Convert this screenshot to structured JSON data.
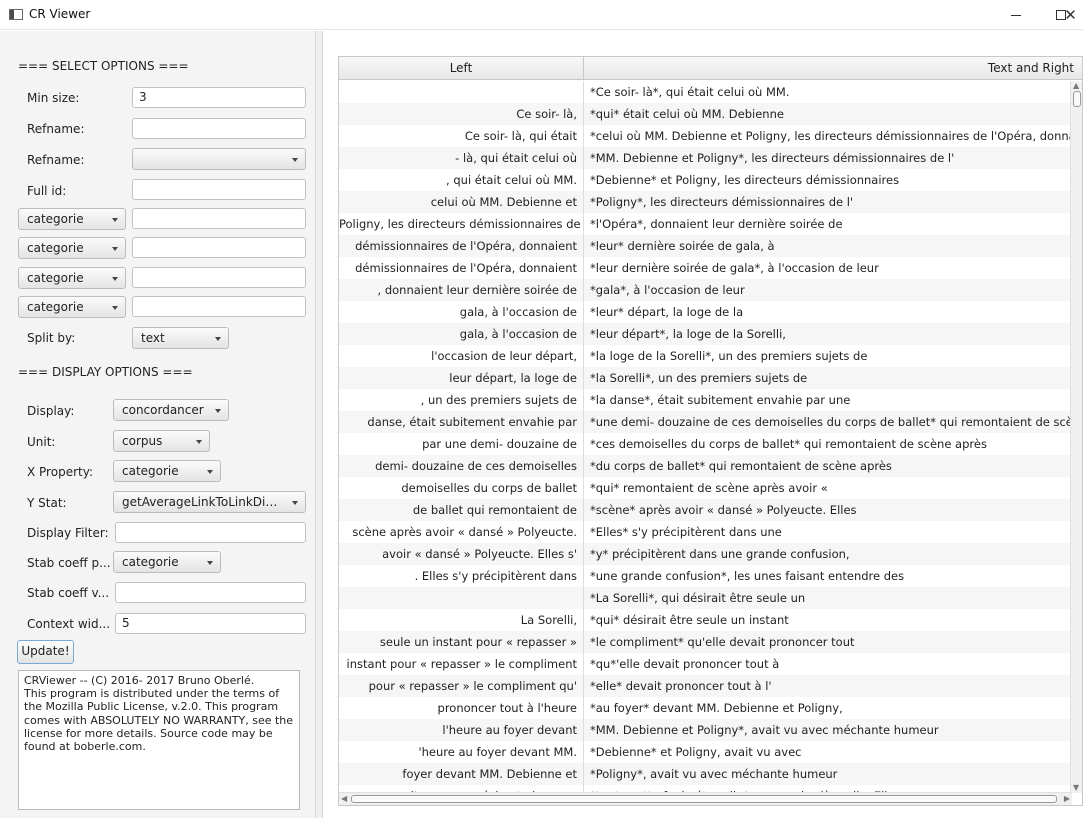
{
  "window": {
    "title": "CR Viewer",
    "controls": {
      "minimize": "–",
      "maximize": "☐",
      "close": "✕"
    }
  },
  "select_options": {
    "header": "=== SELECT OPTIONS ===",
    "min_size": {
      "label": "Min size:",
      "value": "3"
    },
    "refname_text": {
      "label": "Refname:",
      "value": ""
    },
    "refname_combo": {
      "label": "Refname:",
      "value": ""
    },
    "full_id": {
      "label": "Full id:",
      "value": ""
    },
    "categorie_filters": [
      {
        "combo": "categorie",
        "value": ""
      },
      {
        "combo": "categorie",
        "value": ""
      },
      {
        "combo": "categorie",
        "value": ""
      },
      {
        "combo": "categorie",
        "value": ""
      }
    ],
    "split_by": {
      "label": "Split by:",
      "value": "text"
    }
  },
  "display_options": {
    "header": "=== DISPLAY OPTIONS ===",
    "display": {
      "label": "Display:",
      "value": "concordancer"
    },
    "unit": {
      "label": "Unit:",
      "value": "corpus"
    },
    "x_property": {
      "label": "X Property:",
      "value": "categorie"
    },
    "y_stat": {
      "label": "Y Stat:",
      "value": "getAverageLinkToLinkDist..."
    },
    "display_filter": {
      "label": "Display Filter:",
      "value": ""
    },
    "stab_coeff_p": {
      "label": "Stab coeff p...",
      "value": "categorie"
    },
    "stab_coeff_v": {
      "label": "Stab coeff v...",
      "value": ""
    },
    "context_width": {
      "label": "Context wid...",
      "value": "5"
    }
  },
  "update_button": "Update!",
  "about_text": "CRViewer -- (C) 2016- 2017 Bruno Oberlé.\nThis program is distributed under the terms of the Mozilla Public License, v.2.0. This program comes with ABSOLUTELY NO WARRANTY, see the license for more details. Source code may be found at boberle.com.",
  "table": {
    "columns": [
      "Left",
      "Text and Right"
    ],
    "rows": [
      {
        "left": "",
        "right": "*Ce soir- là*, qui était celui où MM."
      },
      {
        "left": "Ce soir- là,",
        "right": "*qui* était celui où MM. Debienne"
      },
      {
        "left": "Ce soir- là, qui était",
        "right": "*celui où MM. Debienne et Poligny, les directeurs démissionnaires de l'Opéra, donnaient le"
      },
      {
        "left": "- là, qui était celui où",
        "right": "*MM. Debienne et Poligny*, les directeurs démissionnaires de l'"
      },
      {
        "left": ", qui était celui où MM.",
        "right": "*Debienne* et Poligny, les directeurs démissionnaires"
      },
      {
        "left": "celui où MM. Debienne et",
        "right": "*Poligny*, les directeurs démissionnaires de l'"
      },
      {
        "left": "Poligny, les directeurs démissionnaires de",
        "right": "*l'Opéra*, donnaient leur dernière soirée de"
      },
      {
        "left": "démissionnaires de l'Opéra, donnaient",
        "right": "*leur* dernière soirée de gala, à"
      },
      {
        "left": "démissionnaires de l'Opéra, donnaient",
        "right": "*leur dernière soirée de gala*, à l'occasion de leur"
      },
      {
        "left": ", donnaient leur dernière soirée de",
        "right": "*gala*, à l'occasion de leur"
      },
      {
        "left": "gala, à l'occasion de",
        "right": "*leur* départ, la loge de la"
      },
      {
        "left": "gala, à l'occasion de",
        "right": "*leur départ*, la loge de la Sorelli,"
      },
      {
        "left": "l'occasion de leur départ,",
        "right": "*la loge de la Sorelli*, un des premiers sujets de"
      },
      {
        "left": "leur départ, la loge de",
        "right": "*la Sorelli*, un des premiers sujets de"
      },
      {
        "left": ", un des premiers sujets de",
        "right": "*la danse*, était subitement envahie par une"
      },
      {
        "left": "danse, était subitement envahie par",
        "right": "*une demi- douzaine de ces demoiselles du corps de ballet* qui remontaient de scène après"
      },
      {
        "left": "par une demi- douzaine de",
        "right": "*ces demoiselles du corps de ballet* qui remontaient de scène après"
      },
      {
        "left": "demi- douzaine de ces demoiselles",
        "right": "*du corps de ballet* qui remontaient de scène après"
      },
      {
        "left": "demoiselles du corps de ballet",
        "right": "*qui* remontaient de scène après avoir «"
      },
      {
        "left": "de ballet qui remontaient de",
        "right": "*scène* après avoir « dansé » Polyeucte. Elles"
      },
      {
        "left": "scène après avoir « dansé » Polyeucte.",
        "right": "*Elles* s'y précipitèrent dans une"
      },
      {
        "left": "avoir « dansé » Polyeucte. Elles s'",
        "right": "*y* précipitèrent dans une grande confusion,"
      },
      {
        "left": ". Elles s'y précipitèrent dans",
        "right": "*une grande confusion*, les unes faisant entendre des"
      },
      {
        "left": "",
        "right": "*La Sorelli*, qui désirait être seule un"
      },
      {
        "left": "La Sorelli,",
        "right": "*qui* désirait être seule un instant"
      },
      {
        "left": "seule un instant pour « repasser »",
        "right": "*le compliment* qu'elle devait prononcer tout"
      },
      {
        "left": "instant pour « repasser » le compliment",
        "right": "*qu*'elle devait prononcer tout à"
      },
      {
        "left": "pour « repasser » le compliment qu'",
        "right": "*elle* devait prononcer tout à l'"
      },
      {
        "left": "prononcer tout à l'heure",
        "right": "*au foyer* devant MM. Debienne et Poligny,"
      },
      {
        "left": "l'heure au foyer devant",
        "right": "*MM. Debienne et Poligny*, avait vu avec méchante humeur"
      },
      {
        "left": "'heure au foyer devant MM.",
        "right": "*Debienne* et Poligny, avait vu avec"
      },
      {
        "left": "foyer devant MM. Debienne et",
        "right": "*Poligny*, avait vu avec méchante humeur"
      },
      {
        "left": ", avait vu avec méchante humeur",
        "right": "*toute cette foule étourdie* se ruer derrière elle. Elle"
      }
    ]
  }
}
